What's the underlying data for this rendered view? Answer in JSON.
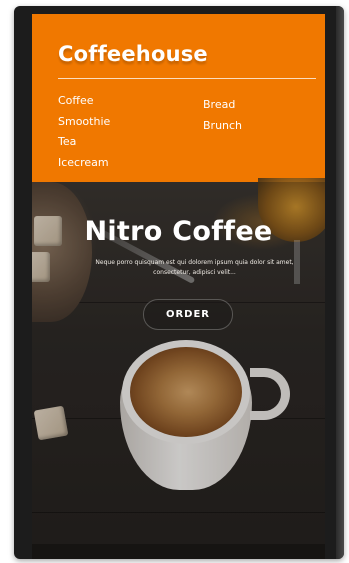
{
  "header": {
    "brand": "Coffeehouse",
    "menu_left": [
      "Coffee",
      "Smoothie",
      "Tea",
      "Icecream"
    ],
    "menu_right": [
      "Bread",
      "Brunch"
    ],
    "accent_color": "#f07800"
  },
  "hero": {
    "title": "Nitro Coffee",
    "description": "Neque porro quisquam est qui dolorem ipsum quia dolor sit amet, consectetur, adipisci velit...",
    "order_label": "ORDER"
  }
}
